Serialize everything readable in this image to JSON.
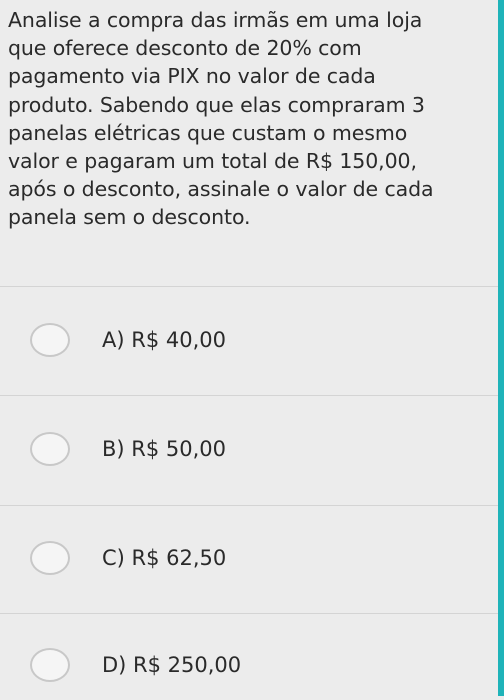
{
  "question": {
    "lines": [
      "Analise a compra das irmãs em uma loja",
      "que oferece desconto de 20% com",
      "pagamento via PIX no valor de cada",
      "produto. Sabendo que elas compraram 3",
      "panelas elétricas que custam o mesmo",
      "valor e pagaram um total de R$ 150,00,",
      "após o desconto, assinale o valor de cada",
      "panela sem o desconto."
    ]
  },
  "options": [
    {
      "label": "A) R$ 40,00"
    },
    {
      "label": "B) R$ 50,00"
    },
    {
      "label": "C) R$ 62,50"
    },
    {
      "label": "D) R$ 250,00"
    }
  ],
  "colors": {
    "background": "#ececec",
    "accent_strip": "#1fb3b9",
    "divider": "#d4d4d4",
    "text": "#2a2a2a"
  }
}
